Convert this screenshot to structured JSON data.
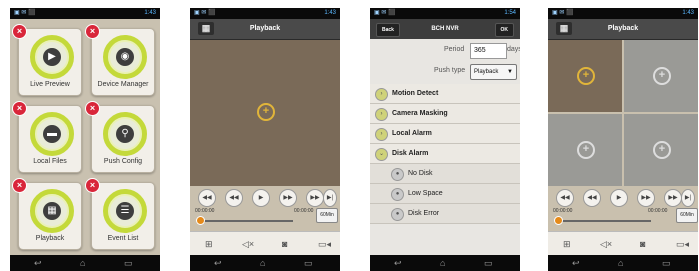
{
  "status": {
    "left": "▣ ✉ ⬛",
    "time_1": "1:43",
    "time_3": "1:54"
  },
  "menu": {
    "tiles": [
      {
        "label": "Live Preview",
        "icon": "camera-icon"
      },
      {
        "label": "Device Manager",
        "icon": "device-icon"
      },
      {
        "label": "Local Files",
        "icon": "folder-icon"
      },
      {
        "label": "Push Config",
        "icon": "push-icon"
      },
      {
        "label": "Playback",
        "icon": "film-icon"
      },
      {
        "label": "Event List",
        "icon": "list-icon"
      }
    ]
  },
  "playback": {
    "title": "Playback",
    "time_start": "00:00:00",
    "time_end": "00:00:00",
    "min_label": "60Min"
  },
  "settings": {
    "title": "BCH NVR",
    "back_label": "Back",
    "ok_label": "OK",
    "period_label": "Period",
    "period_value": "365",
    "period_unit": "days",
    "push_type_label": "Push type",
    "push_type_value": "Playback",
    "items": [
      {
        "label": "Motion Detect"
      },
      {
        "label": "Camera Masking"
      },
      {
        "label": "Local Alarm"
      },
      {
        "label": "Disk Alarm"
      }
    ],
    "sub_items": [
      {
        "label": "No Disk"
      },
      {
        "label": "Low Space"
      },
      {
        "label": "Disk Error"
      }
    ]
  }
}
